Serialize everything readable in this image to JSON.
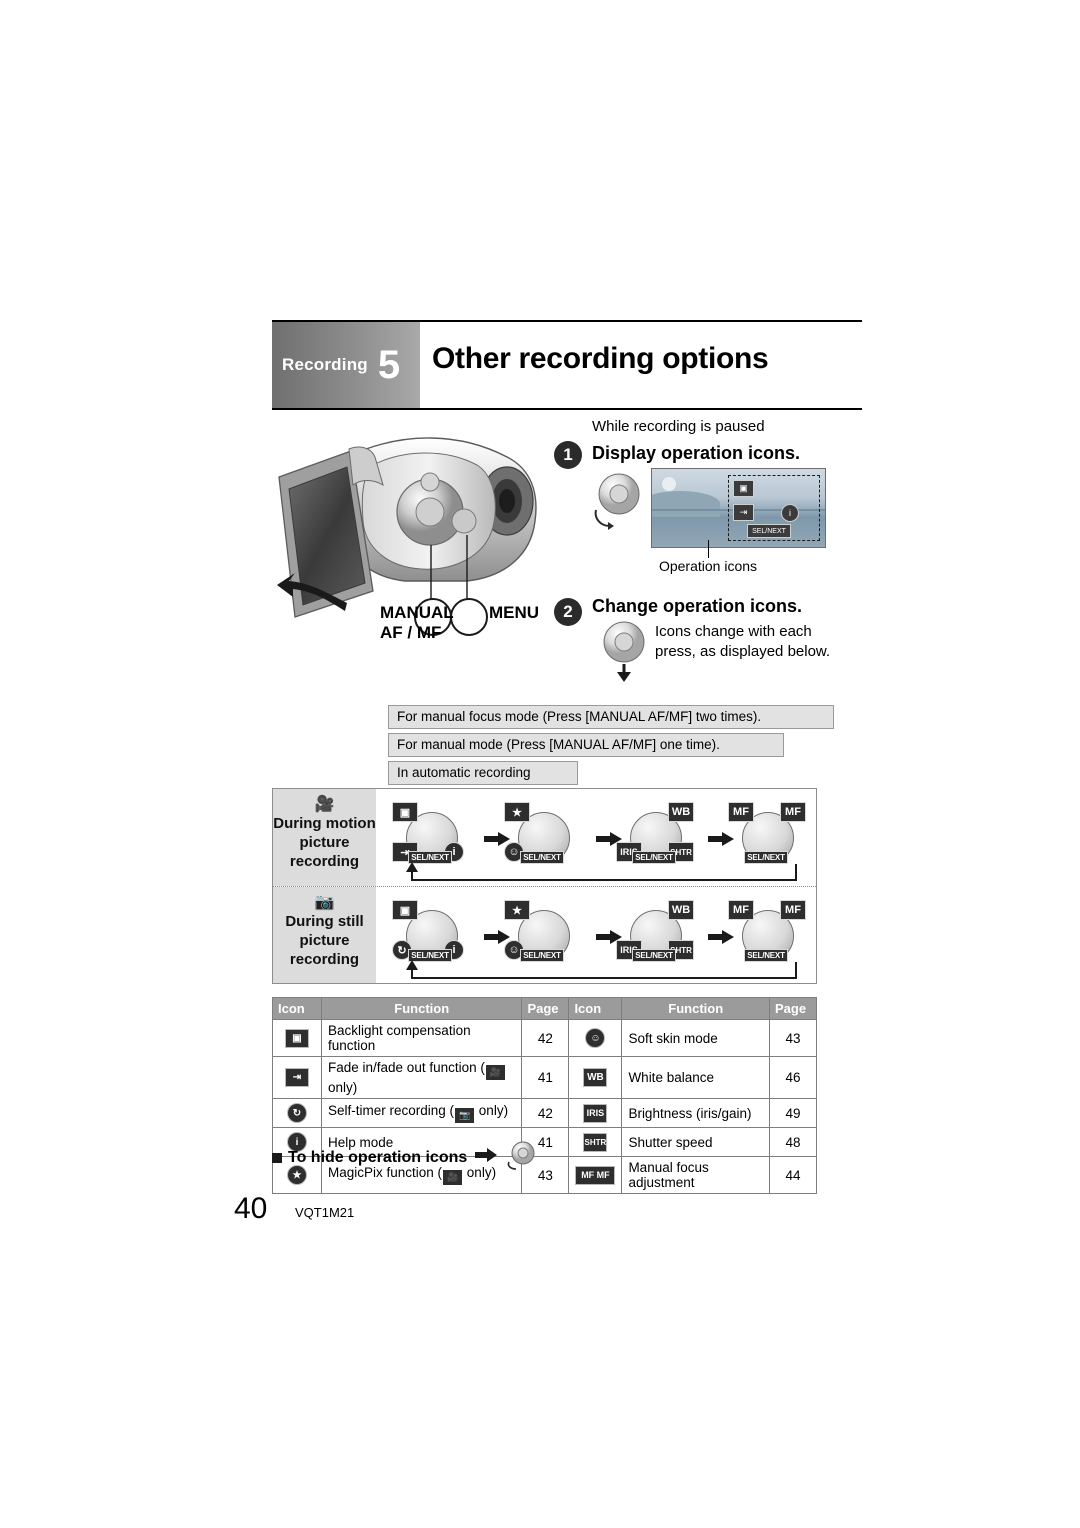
{
  "header": {
    "section_label": "Recording",
    "section_number": "5",
    "title": "Other recording options"
  },
  "step1": {
    "badge": "1",
    "intro": "While recording is paused",
    "title": "Display operation icons.",
    "caption": "Operation icons"
  },
  "step2": {
    "badge": "2",
    "title": "Change operation icons.",
    "text": "Icons change with each press, as displayed below."
  },
  "camera_labels": {
    "manual_line1": "MANUAL",
    "manual_line2": "AF / MF",
    "menu": "MENU"
  },
  "flow": {
    "notes": [
      "For manual focus mode (Press [MANUAL AF/MF] two times).",
      "For manual mode (Press [MANUAL AF/MF] one time).",
      "In automatic recording"
    ],
    "rows": [
      {
        "mode_icon": "video-camera-icon",
        "mode_label": "During motion picture recording",
        "steps": [
          {
            "tl": "backlight-icon",
            "tl_text": "",
            "tr": "",
            "bl": "fade-icon",
            "br": "help-icon",
            "sel": "SEL/NEXT"
          },
          {
            "tl": "magicpix-icon",
            "tl_text": "",
            "tr": "",
            "bl": "soft-skin-icon",
            "br": "",
            "sel": "SEL/NEXT"
          },
          {
            "tl": "",
            "tr": "white-balance-icon",
            "tr_text": "WB",
            "bl": "iris-icon",
            "bl_text": "IRIS",
            "br": "shutter-icon",
            "br_text": "SHTR",
            "sel": "SEL/NEXT"
          },
          {
            "tl": "manual-focus-icon",
            "tl_text": "MF",
            "tr": "manual-focus-plus-icon",
            "tr_text": "MF",
            "bl": "",
            "br": "",
            "sel": "SEL/NEXT"
          }
        ]
      },
      {
        "mode_icon": "still-camera-icon",
        "mode_label": "During still picture recording",
        "steps": [
          {
            "tl": "backlight-icon",
            "tr": "",
            "bl": "self-timer-icon",
            "br": "help-icon",
            "sel": "SEL/NEXT"
          },
          {
            "tl": "magicpix-icon",
            "tr": "",
            "bl": "soft-skin-icon",
            "br": "",
            "sel": "SEL/NEXT"
          },
          {
            "tl": "",
            "tr": "white-balance-icon",
            "tr_text": "WB",
            "bl": "iris-icon",
            "bl_text": "IRIS",
            "br": "shutter-icon",
            "br_text": "SHTR",
            "sel": "SEL/NEXT"
          },
          {
            "tl": "manual-focus-icon",
            "tl_text": "MF",
            "tr": "manual-focus-plus-icon",
            "tr_text": "MF",
            "bl": "",
            "br": "",
            "sel": "SEL/NEXT"
          }
        ]
      }
    ]
  },
  "table": {
    "headers": [
      "Icon",
      "Function",
      "Page",
      "Icon",
      "Function",
      "Page"
    ],
    "rows": [
      {
        "left_icon": "backlight-icon",
        "left_function": "Backlight compensation function",
        "left_page": "42",
        "right_icon": "soft-skin-icon",
        "right_function": "Soft skin mode",
        "right_page": "43"
      },
      {
        "left_icon": "fade-icon",
        "left_function_pre": "Fade in/fade out function (",
        "left_function_post": " only)",
        "left_function_ico": "video-camera-icon",
        "left_page": "41",
        "right_icon": "white-balance-icon",
        "right_icon_text": "WB",
        "right_function": "White balance",
        "right_page": "46"
      },
      {
        "left_icon": "self-timer-icon",
        "left_function_pre": "Self-timer recording (",
        "left_function_post": " only)",
        "left_function_ico": "still-camera-icon",
        "left_page": "42",
        "right_icon": "iris-icon",
        "right_icon_text": "IRIS",
        "right_function": "Brightness (iris/gain)",
        "right_page": "49"
      },
      {
        "left_icon": "help-icon",
        "left_function": "Help mode",
        "left_page": "41",
        "right_icon": "shutter-icon",
        "right_icon_text": "SHTR",
        "right_function": "Shutter speed",
        "right_page": "48"
      },
      {
        "left_icon": "magicpix-icon",
        "left_function_pre": "MagicPix function (",
        "left_function_post": " only)",
        "left_function_ico": "video-camera-icon",
        "left_page": "43",
        "right_icon": "manual-focus-icon",
        "right_icon_text": "MF MF",
        "right_function": "Manual focus adjustment",
        "right_page": "44"
      }
    ]
  },
  "footer": {
    "hide_text": "To hide operation icons",
    "page_number": "40",
    "doc_code": "VQT1M21"
  }
}
